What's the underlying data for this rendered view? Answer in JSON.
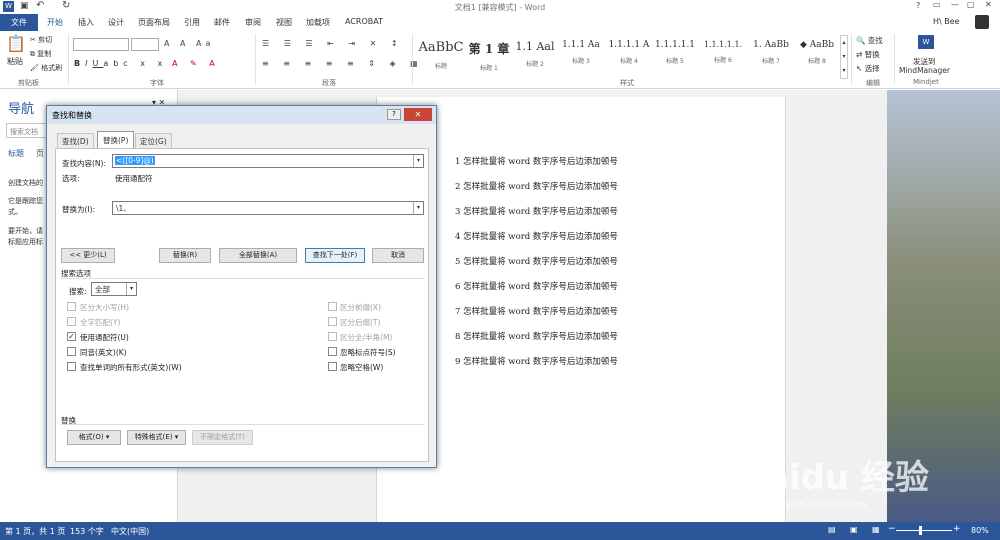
{
  "window": {
    "title": "文档1 [兼容模式] - Word",
    "help": "?",
    "user": "H\\ Bee"
  },
  "ribbon_tabs": [
    "文件",
    "开始",
    "插入",
    "设计",
    "页面布局",
    "引用",
    "邮件",
    "审阅",
    "视图",
    "加载项",
    "ACROBAT"
  ],
  "ribbon": {
    "clipboard": {
      "paste": "粘贴",
      "cut": "剪切",
      "copy": "复制",
      "format_painter": "格式刷",
      "group": "剪贴板"
    },
    "font_group": "字体",
    "paragraph_group": "段落",
    "styles": [
      {
        "sample": "AaBbC",
        "label": "标题"
      },
      {
        "sample": "第 1 章",
        "label": "标题 1"
      },
      {
        "sample": "1.1 Aal",
        "label": "标题 2"
      },
      {
        "sample": "1.1.1 Aa",
        "label": "标题 3"
      },
      {
        "sample": "1.1.1.1 A",
        "label": "标题 4"
      },
      {
        "sample": "1.1.1.1.1",
        "label": "标题 5"
      },
      {
        "sample": "1.1.1.1.1.",
        "label": "标题 6"
      },
      {
        "sample": "1. AaBb",
        "label": "标题 7"
      },
      {
        "sample": "◆ AaBb",
        "label": "标题 8"
      }
    ],
    "styles_group": "样式",
    "editing": {
      "find": "查找",
      "replace": "替换",
      "select": "选择",
      "group": "编辑"
    },
    "mindjet": {
      "send": "发送到",
      "app": "MindManager",
      "group": "Mindjet"
    }
  },
  "nav": {
    "title": "导航",
    "search_placeholder": "搜索文档",
    "tab_headings": "标题",
    "tab_pages": "页",
    "text1": "创建文档的",
    "text2": "它是跟踪您",
    "text3": "式。",
    "text4": "要开始，请",
    "text5": "标题应用标"
  },
  "document_lines": [
    "1 怎样批量将 word 数字序号后边添加顿号",
    "2 怎样批量将 word 数字序号后边添加顿号",
    "3 怎样批量将 word 数字序号后边添加顿号",
    "4 怎样批量将 word 数字序号后边添加顿号",
    "5 怎样批量将 word 数字序号后边添加顿号",
    "6 怎样批量将 word 数字序号后边添加顿号",
    "7 怎样批量将 word 数字序号后边添加顿号",
    "8 怎样批量将 word 数字序号后边添加顿号",
    "9 怎样批量将 word 数字序号后边添加顿号"
  ],
  "dialog": {
    "title": "查找和替换",
    "help": "?",
    "close": "✕",
    "tabs": [
      "查找(D)",
      "替换(P)",
      "定位(G)"
    ],
    "find_label": "查找内容(N):",
    "find_value": "<([0-9]@)",
    "options_label": "选项:",
    "options_value": "使用通配符",
    "replace_label": "替换为(I):",
    "replace_value": "\\1、",
    "buttons": {
      "less": "<< 更少(L)",
      "replace": "替换(R)",
      "replace_all": "全部替换(A)",
      "find_next": "查找下一处(F)",
      "cancel": "取消"
    },
    "search_options": "搜索选项",
    "search_label": "搜索:",
    "search_scope": "全部",
    "left_options": [
      {
        "label": "区分大小写(H)",
        "checked": false,
        "disabled": true
      },
      {
        "label": "全字匹配(Y)",
        "checked": false,
        "disabled": true
      },
      {
        "label": "使用通配符(U)",
        "checked": true,
        "disabled": false
      },
      {
        "label": "同音(英文)(K)",
        "checked": false,
        "disabled": false
      },
      {
        "label": "查找单词的所有形式(英文)(W)",
        "checked": false,
        "disabled": false
      }
    ],
    "right_options": [
      {
        "label": "区分前缀(X)",
        "checked": false,
        "disabled": true
      },
      {
        "label": "区分后缀(T)",
        "checked": false,
        "disabled": true
      },
      {
        "label": "区分全/半角(M)",
        "checked": false,
        "disabled": true
      },
      {
        "label": "忽略标点符号(S)",
        "checked": false,
        "disabled": false
      },
      {
        "label": "忽略空格(W)",
        "checked": false,
        "disabled": false
      }
    ],
    "replace_section": "替换",
    "format_btn": "格式(O) ▾",
    "special_btn": "特殊格式(E) ▾",
    "no_format_btn": "不限定格式(T)"
  },
  "status": {
    "page": "第 1 页，共 1 页",
    "words": "153 个字",
    "lang": "中文(中国)",
    "zoom": "80%"
  },
  "watermark": {
    "brand": "Baidu 经验",
    "url": "jingyan.baidu.com"
  }
}
